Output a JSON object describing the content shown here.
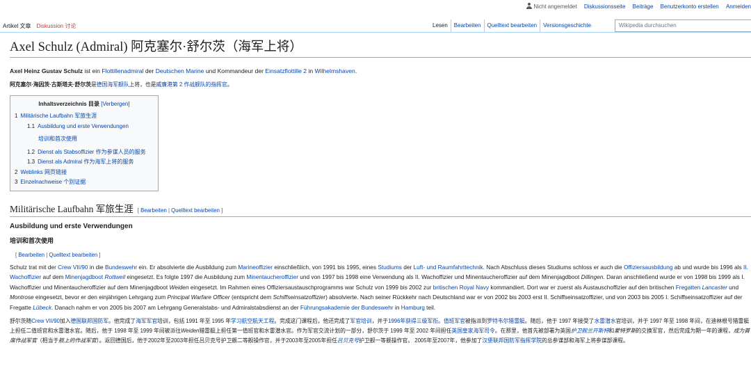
{
  "personal": {
    "not_logged_in": "Nicht angemeldet",
    "talk": "Diskussionsseite",
    "contributions": "Beiträge",
    "create_account": "Benutzerkonto erstellen",
    "login": "Anmelden"
  },
  "tabs": {
    "article": "Artikel 文章",
    "discussion": "Diskussion 讨论",
    "read": "Lesen",
    "edit": "Bearbeiten",
    "edit_source": "Quelltext bearbeiten",
    "history": "Versionsgeschichte"
  },
  "search": {
    "placeholder": "Wikipedia durchsuchen"
  },
  "title": "Axel Schulz (Admiral) 阿克塞尔·舒尔茨（海军上将）",
  "lead": {
    "bold": "Axel Heinz Gustav Schulz",
    "t1": " ist ein ",
    "l1": "Flottillenadmiral",
    "t2": " der ",
    "l2": "Deutschen Marine",
    "t3": " und Kommandeur der ",
    "l3": "Einsatzflottille 2",
    "t4": " in ",
    "l4": "Wilhelmshaven",
    "t5": "."
  },
  "lead_cn": {
    "bold": "阿克塞尔·海因茨·古斯塔夫·舒尔茨",
    "t1": "是",
    "l1": "德国海军舰队",
    "t2": "上将，也是",
    "l2": "威廉港第 2 作战舰队的",
    "l3": "指挥官",
    "t3": "。"
  },
  "toc": {
    "title": "Inhaltsverzeichnis 目录",
    "toggle": "[Verbergen]",
    "items": [
      {
        "num": "1",
        "text": "Militärische Laufbahn 军旅生涯"
      },
      {
        "num": "1.1",
        "text": "Ausbildung und erste Verwendungen"
      },
      {
        "num": "",
        "text": "培训和首次使用"
      },
      {
        "num": "1.2",
        "text": "Dienst als Stabsoffizier 作为参谋人员的服务"
      },
      {
        "num": "1.3",
        "text": "Dienst als Admiral 作为海军上将的服务"
      },
      {
        "num": "2",
        "text": "Weblinks 网页链接"
      },
      {
        "num": "3",
        "text": "Einzelnachweise 个别证据"
      }
    ]
  },
  "section1": {
    "heading": "Militärische Laufbahn 军旅生涯",
    "edit": "Bearbeiten",
    "edit_source": "Quelltext bearbeiten"
  },
  "sub1": {
    "heading": "Ausbildung und erste Verwendungen"
  },
  "sub1_cn": {
    "heading": "培训和首次使用",
    "edit": "Bearbeiten",
    "edit_source": "Quelltext bearbeiten"
  },
  "para_de": [
    {
      "t": "Schulz trat mit der "
    },
    {
      "l": "Crew VII/90"
    },
    {
      "t": " in die "
    },
    {
      "l": "Bundeswehr"
    },
    {
      "t": " ein. Er absolvierte die Ausbildung zum "
    },
    {
      "l": "Marineoffizier"
    },
    {
      "t": " einschließlich, von 1991 bis 1995, eines "
    },
    {
      "l": "Studiums"
    },
    {
      "t": " der "
    },
    {
      "l": "Luft- und Raumfahrttechnik"
    },
    {
      "t": ". Nach Abschluss dieses Studiums schloss er auch die "
    },
    {
      "l": "Offiziersausbildung"
    },
    {
      "t": " ab und wurde bis 1996 als "
    },
    {
      "l": "II. Wachoffizier"
    },
    {
      "t": " auf dem "
    },
    {
      "l": "Minenjagdboot"
    },
    {
      "t": " "
    },
    {
      "li": "Rottweil"
    },
    {
      "t": " eingesetzt. Es folgte 1997 die Ausbildung zum "
    },
    {
      "l": "Minentaucheroffizier"
    },
    {
      "t": " und von 1997 bis 1998 eine Verwendung als II. Wachoffizier und Minentaucheroffizier auf dem Minenjagdboot "
    },
    {
      "i": "Dillingen"
    },
    {
      "t": ". Daran anschließend wurde er von 1998 bis 1999 als I. Wachoffizier und Minentaucheroffizier auf dem Minenjagdboot "
    },
    {
      "i": "Weiden"
    },
    {
      "t": " eingesetzt. Im Rahmen eines Offiziersaustauschprogramms war Schulz von 1999 bis 2002 zur "
    },
    {
      "l": "britischen"
    },
    {
      "t": " "
    },
    {
      "l": "Royal Navy"
    },
    {
      "t": " kommandiert. Dort war er zuerst als Austauschoffizier auf den britischen "
    },
    {
      "l": "Fregatten"
    },
    {
      "t": " "
    },
    {
      "li": "Lancaster"
    },
    {
      "t": " und "
    },
    {
      "i": "Montrose"
    },
    {
      "t": " eingesetzt, bevor er den einjährigen Lehrgang zum "
    },
    {
      "i": "Principal Warfare Officer"
    },
    {
      "t": " (entspricht dem "
    },
    {
      "i": "Schiffseinsatzoffizier"
    },
    {
      "t": ") absolvierte. Nach seiner Rückkehr nach Deutschland war er von 2002 bis 2003 erst II. Schiffseinsatzoffizier, und von 2003 bis 2005 I. Schiffseinsatzoffizier auf der Fregatte "
    },
    {
      "li": "Lübeck"
    },
    {
      "t": ". Danach nahm er von 2005 bis 2007 am Lehrgang Generalstabs- und Admiralstabsdienst an der "
    },
    {
      "l": "Führungsakademie der Bundeswehr"
    },
    {
      "t": " in "
    },
    {
      "l": "Hamburg"
    },
    {
      "t": " teil."
    }
  ],
  "para_cn": [
    {
      "t": "舒尔茨随"
    },
    {
      "l": "Crew VII/90"
    },
    {
      "t": "加入"
    },
    {
      "l": "德国联邦国防军"
    },
    {
      "t": "。他完成了"
    },
    {
      "l": "海军军官"
    },
    {
      "t": "培训，包括 1991 年至 1995 年"
    },
    {
      "l": "学习航空航天工程"
    },
    {
      "t": "。完成这门课程后，他还完成了"
    },
    {
      "l": "军官培训"
    },
    {
      "t": "，并于"
    },
    {
      "l": "1996年获得三级军衔"
    },
    {
      "t": "。"
    },
    {
      "l": "值班军官"
    },
    {
      "t": "被指派到"
    },
    {
      "l": "罗特韦尔猎雷艇"
    },
    {
      "t": "。随后，他于 1997 年接受了"
    },
    {
      "l": "水雷潜水"
    },
    {
      "t": "官培训，并于 1997 年至 1998 年间，在迪林根号猎雷艇上担任二值班官和水雷潜水官。随后，他于 1998 年至 1999 年间被派往"
    },
    {
      "i": "Weiden"
    },
    {
      "t": "猎雷艇上担任第一值班官和水雷潜水官。作为军官交流计划的一部分，舒尔茨于 1999 年至 2002 年间担任"
    },
    {
      "l": "英国皇家海军司令"
    },
    {
      "t": "。在那里，他首先被部署为英国"
    },
    {
      "li": "护卫舰兰开斯特"
    },
    {
      "t": "和"
    },
    {
      "i": "蒙特罗斯"
    },
    {
      "t": "的交换军官，然后完成为期一年的课程，"
    },
    {
      "i": "成为首席作战军官"
    },
    {
      "t": "（相当于"
    },
    {
      "i": "舰上的作战军官"
    },
    {
      "t": "）。返回德国后，他于2002年至2003年担任吕贝克号护卫舰二等舰操作官，并于2003年至2005年担任"
    },
    {
      "li": "吕贝克号"
    },
    {
      "t": "护卫舰一等舰操作官。 2005年至2007年，他参加了"
    },
    {
      "l": "汉堡联邦国防军指挥学院"
    },
    {
      "t": "的总参谋部和海军上将参谋部课程。"
    }
  ]
}
